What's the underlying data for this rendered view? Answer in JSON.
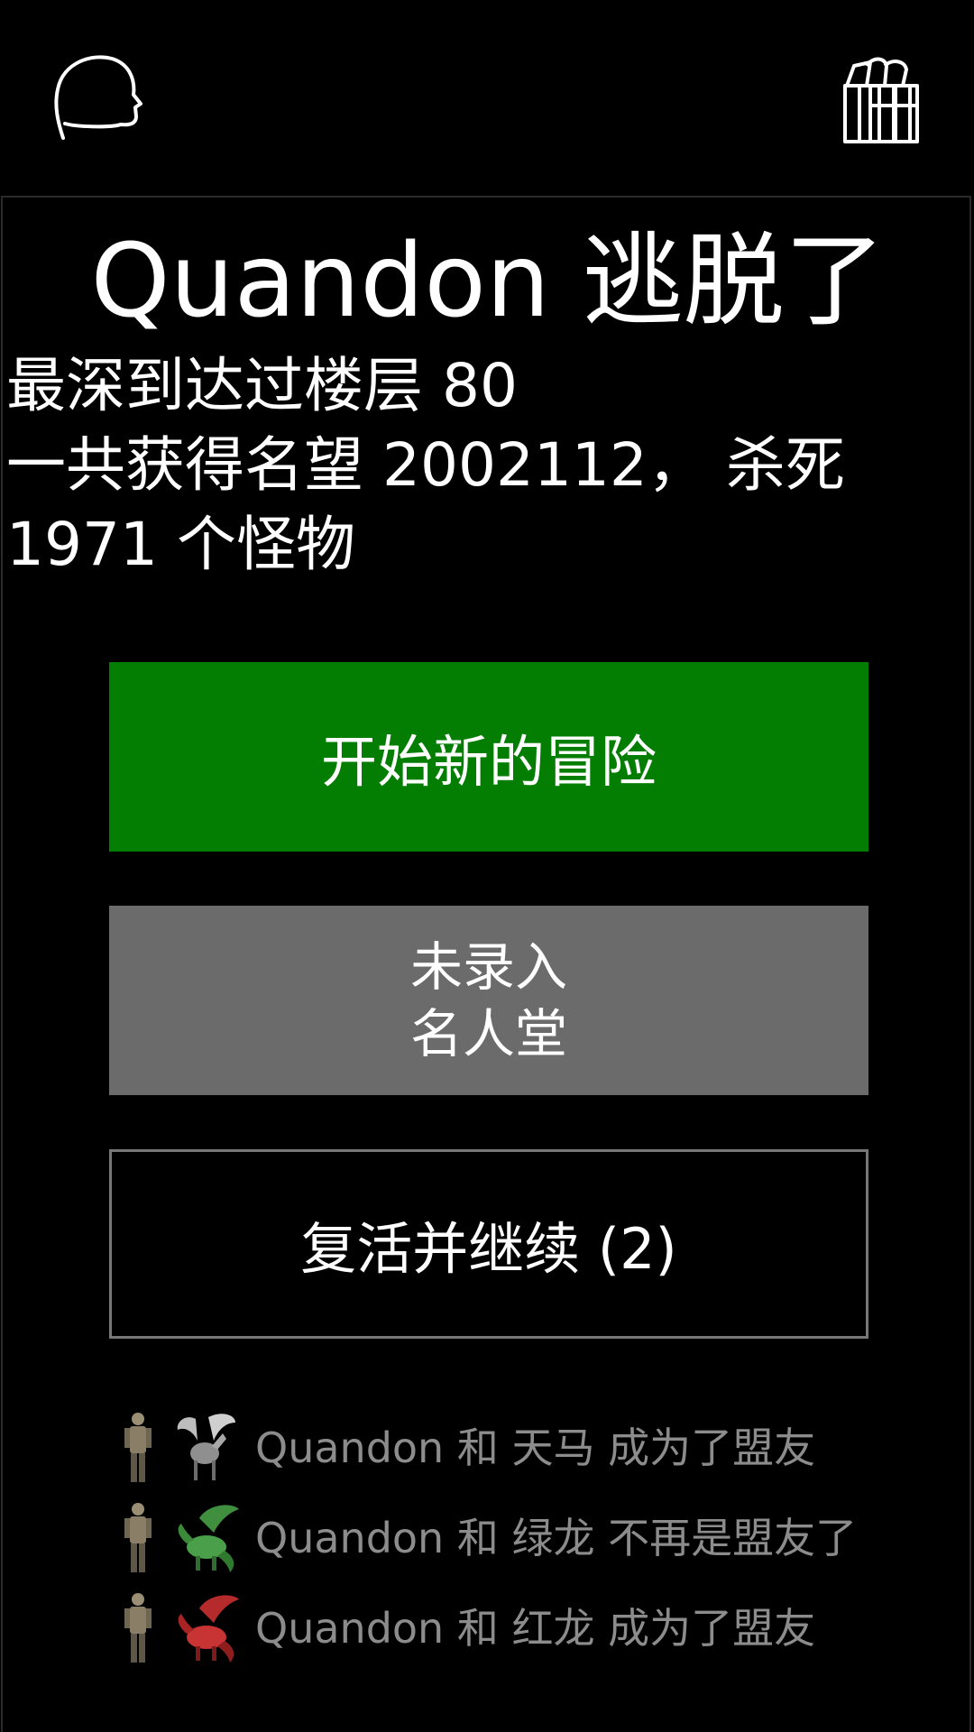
{
  "header": {
    "left_icon": "head-profile-icon",
    "right_icon": "gift-boxes-icon"
  },
  "result": {
    "title": "Quandon 逃脱了",
    "stat_line1": "最深到达过楼层 80",
    "stat_line2": "一共获得名望 2002112， 杀死",
    "stat_line3": "1971 个怪物"
  },
  "buttons": {
    "new_adventure": "开始新的冒险",
    "hall_line1": "未录入",
    "hall_line2": "名人堂",
    "revive": "复活并继续 (2)"
  },
  "colors": {
    "new_adventure_bg": "#037e03",
    "hall_bg": "#6b6b6b",
    "log_text": "#8c8c8c"
  },
  "log": [
    {
      "text": "Quandon 和 天马 成为了盟友",
      "creature": "pegasus-sprite"
    },
    {
      "text": "Quandon 和 绿龙 不再是盟友了",
      "creature": "green-dragon-sprite"
    },
    {
      "text": "Quandon 和 红龙 成为了盟友",
      "creature": "red-dragon-sprite"
    }
  ]
}
